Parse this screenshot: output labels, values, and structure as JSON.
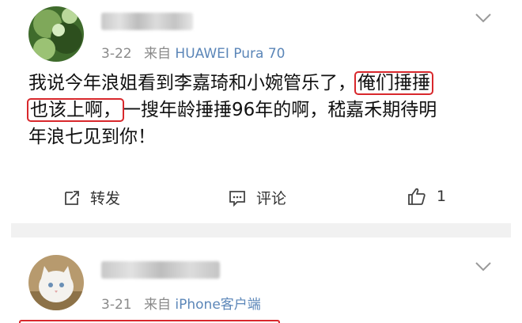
{
  "posts": [
    {
      "date": "3-22",
      "source_prefix": "来自",
      "source": "HUAWEI Pura 70",
      "content_lines": [
        "我说今年浪姐看到李嘉琦和小婉管乐了，",
        "俺们捶捶",
        "也该上啊，",
        "一搜年龄捶捶96年的啊，嵇嘉禾期待明",
        "年浪七见到你！"
      ],
      "actions": {
        "repost_label": "转发",
        "comment_label": "评论",
        "like_count": "1"
      }
    },
    {
      "date": "3-21",
      "source_prefix": "来自",
      "source": "iPhone客户端"
    }
  ],
  "colors": {
    "highlight_border": "#d8282c",
    "source_link": "#5b86b8",
    "meta_text": "#8a8a8a"
  },
  "icons": {
    "repost": "repost-icon",
    "comment": "comment-icon",
    "like": "thumbs-up-icon",
    "more": "chevron-down-icon"
  }
}
